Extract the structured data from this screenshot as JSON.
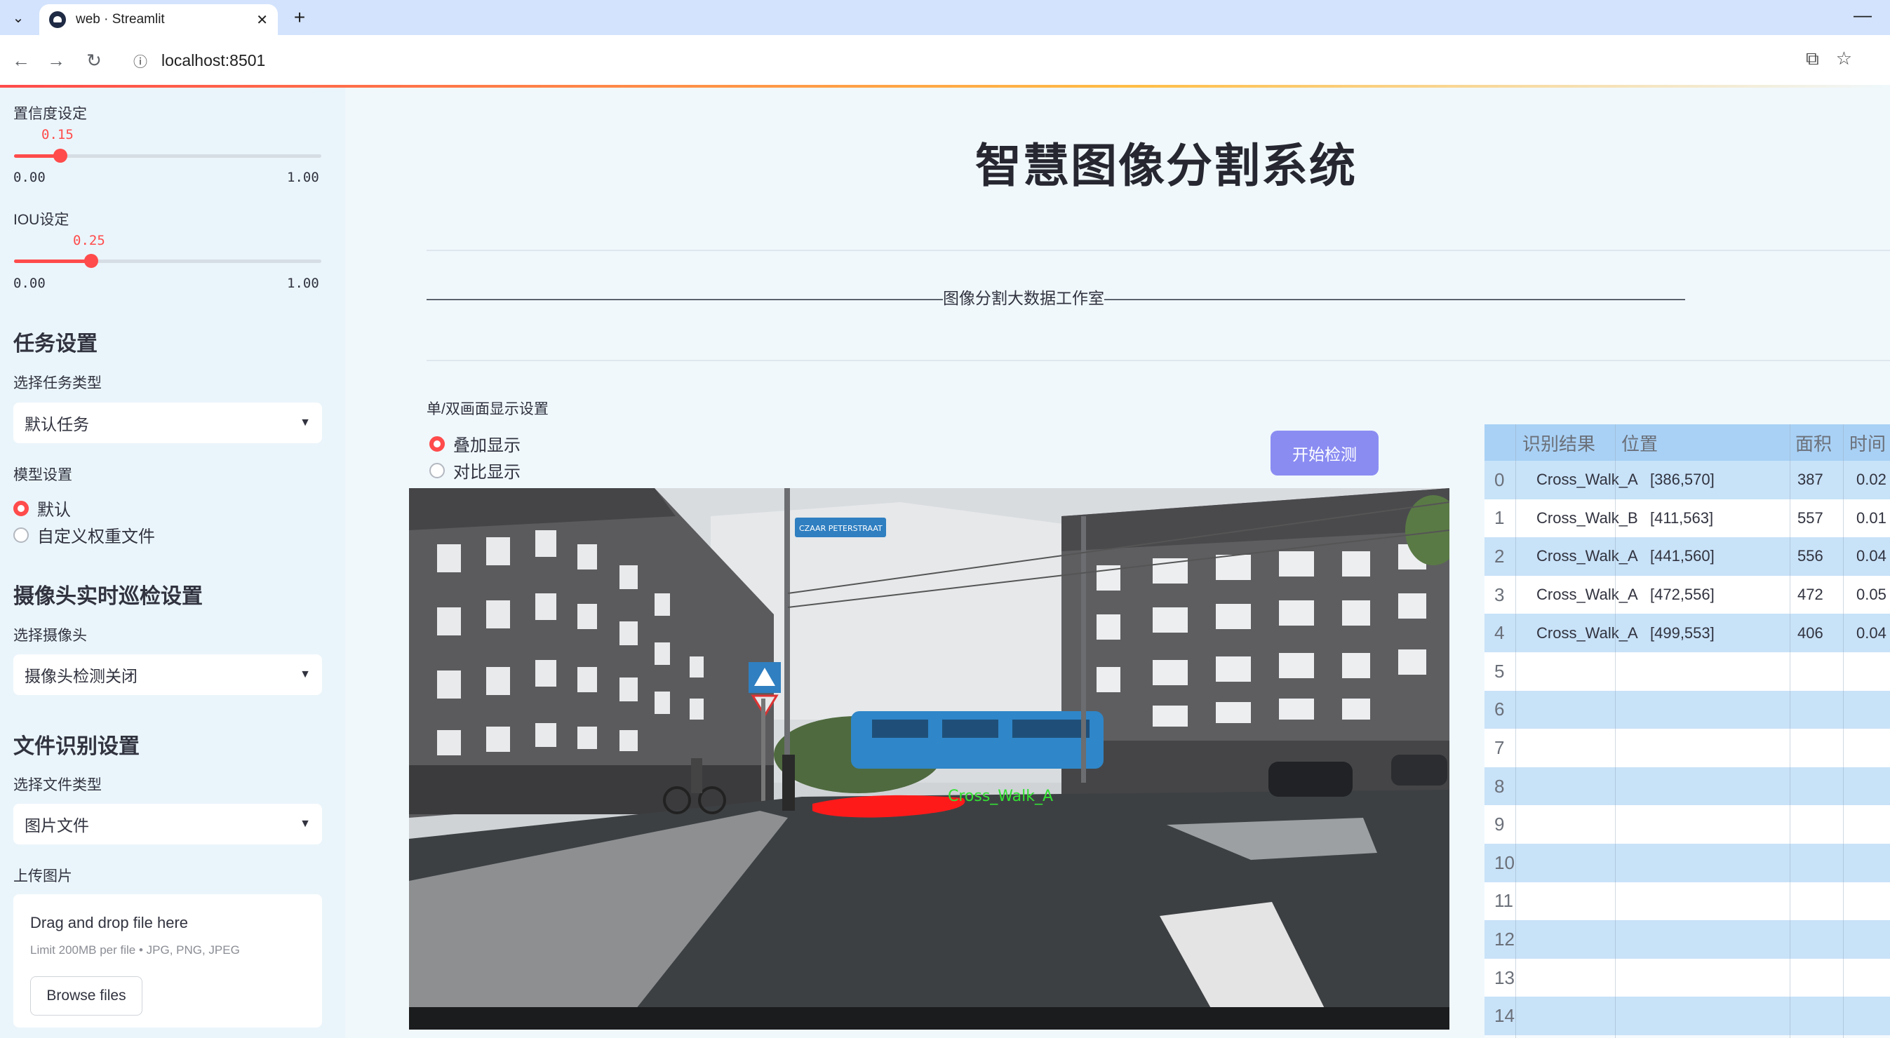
{
  "browser": {
    "tab_title": "web · Streamlit",
    "url": "localhost:8501"
  },
  "sidebar": {
    "confidence": {
      "label": "置信度设定",
      "value": "0.15",
      "value_num": 0.15,
      "min": "0.00",
      "max": "1.00"
    },
    "iou": {
      "label": "IOU设定",
      "value": "0.25",
      "value_num": 0.25,
      "min": "0.00",
      "max": "1.00"
    },
    "task_section": "任务设置",
    "task_type_label": "选择任务类型",
    "task_type_value": "默认任务",
    "model_label": "模型设置",
    "model_options": [
      "默认",
      "自定义权重文件"
    ],
    "camera_section": "摄像头实时巡检设置",
    "camera_label": "选择摄像头",
    "camera_value": "摄像头检测关闭",
    "file_section": "文件识别设置",
    "file_type_label": "选择文件类型",
    "file_type_value": "图片文件",
    "upload_label": "上传图片",
    "upload_title": "Drag and drop file here",
    "upload_limit": "Limit 200MB per file • JPG, PNG, JPEG",
    "browse_button": "Browse files"
  },
  "main": {
    "title": "智慧图像分割系统",
    "studio": "————————————————————————————————图像分割大数据工作室————————————————————————————————————",
    "display_label": "单/双画面显示设置",
    "display_options": [
      "叠加显示",
      "对比显示"
    ],
    "start_button": "开始检测",
    "scene": {
      "street_sign": "CZAAR PETERSTRAAT",
      "detection_label": "Cross_Walk_A"
    }
  },
  "results": {
    "headers": [
      "识别结果",
      "位置",
      "面积",
      "时间"
    ],
    "rows": [
      {
        "index": "0",
        "label": "Cross_Walk_A",
        "pos": "[386,570]",
        "area": "387",
        "time": "0.02"
      },
      {
        "index": "1",
        "label": "Cross_Walk_B",
        "pos": "[411,563]",
        "area": "557",
        "time": "0.01"
      },
      {
        "index": "2",
        "label": "Cross_Walk_A",
        "pos": "[441,560]",
        "area": "556",
        "time": "0.04"
      },
      {
        "index": "3",
        "label": "Cross_Walk_A",
        "pos": "[472,556]",
        "area": "472",
        "time": "0.05"
      },
      {
        "index": "4",
        "label": "Cross_Walk_A",
        "pos": "[499,553]",
        "area": "406",
        "time": "0.04"
      }
    ],
    "empty_indices": [
      "5",
      "6",
      "7",
      "8",
      "9",
      "10",
      "11",
      "12",
      "13",
      "14"
    ]
  },
  "colors": {
    "accent": "#ff4b4b",
    "button": "#8a8cf2",
    "table_header": "#a9d1f5",
    "table_alt_row": "#c8e2f8",
    "detection_mask": "#ff1a1a",
    "detection_text": "#34e234"
  }
}
